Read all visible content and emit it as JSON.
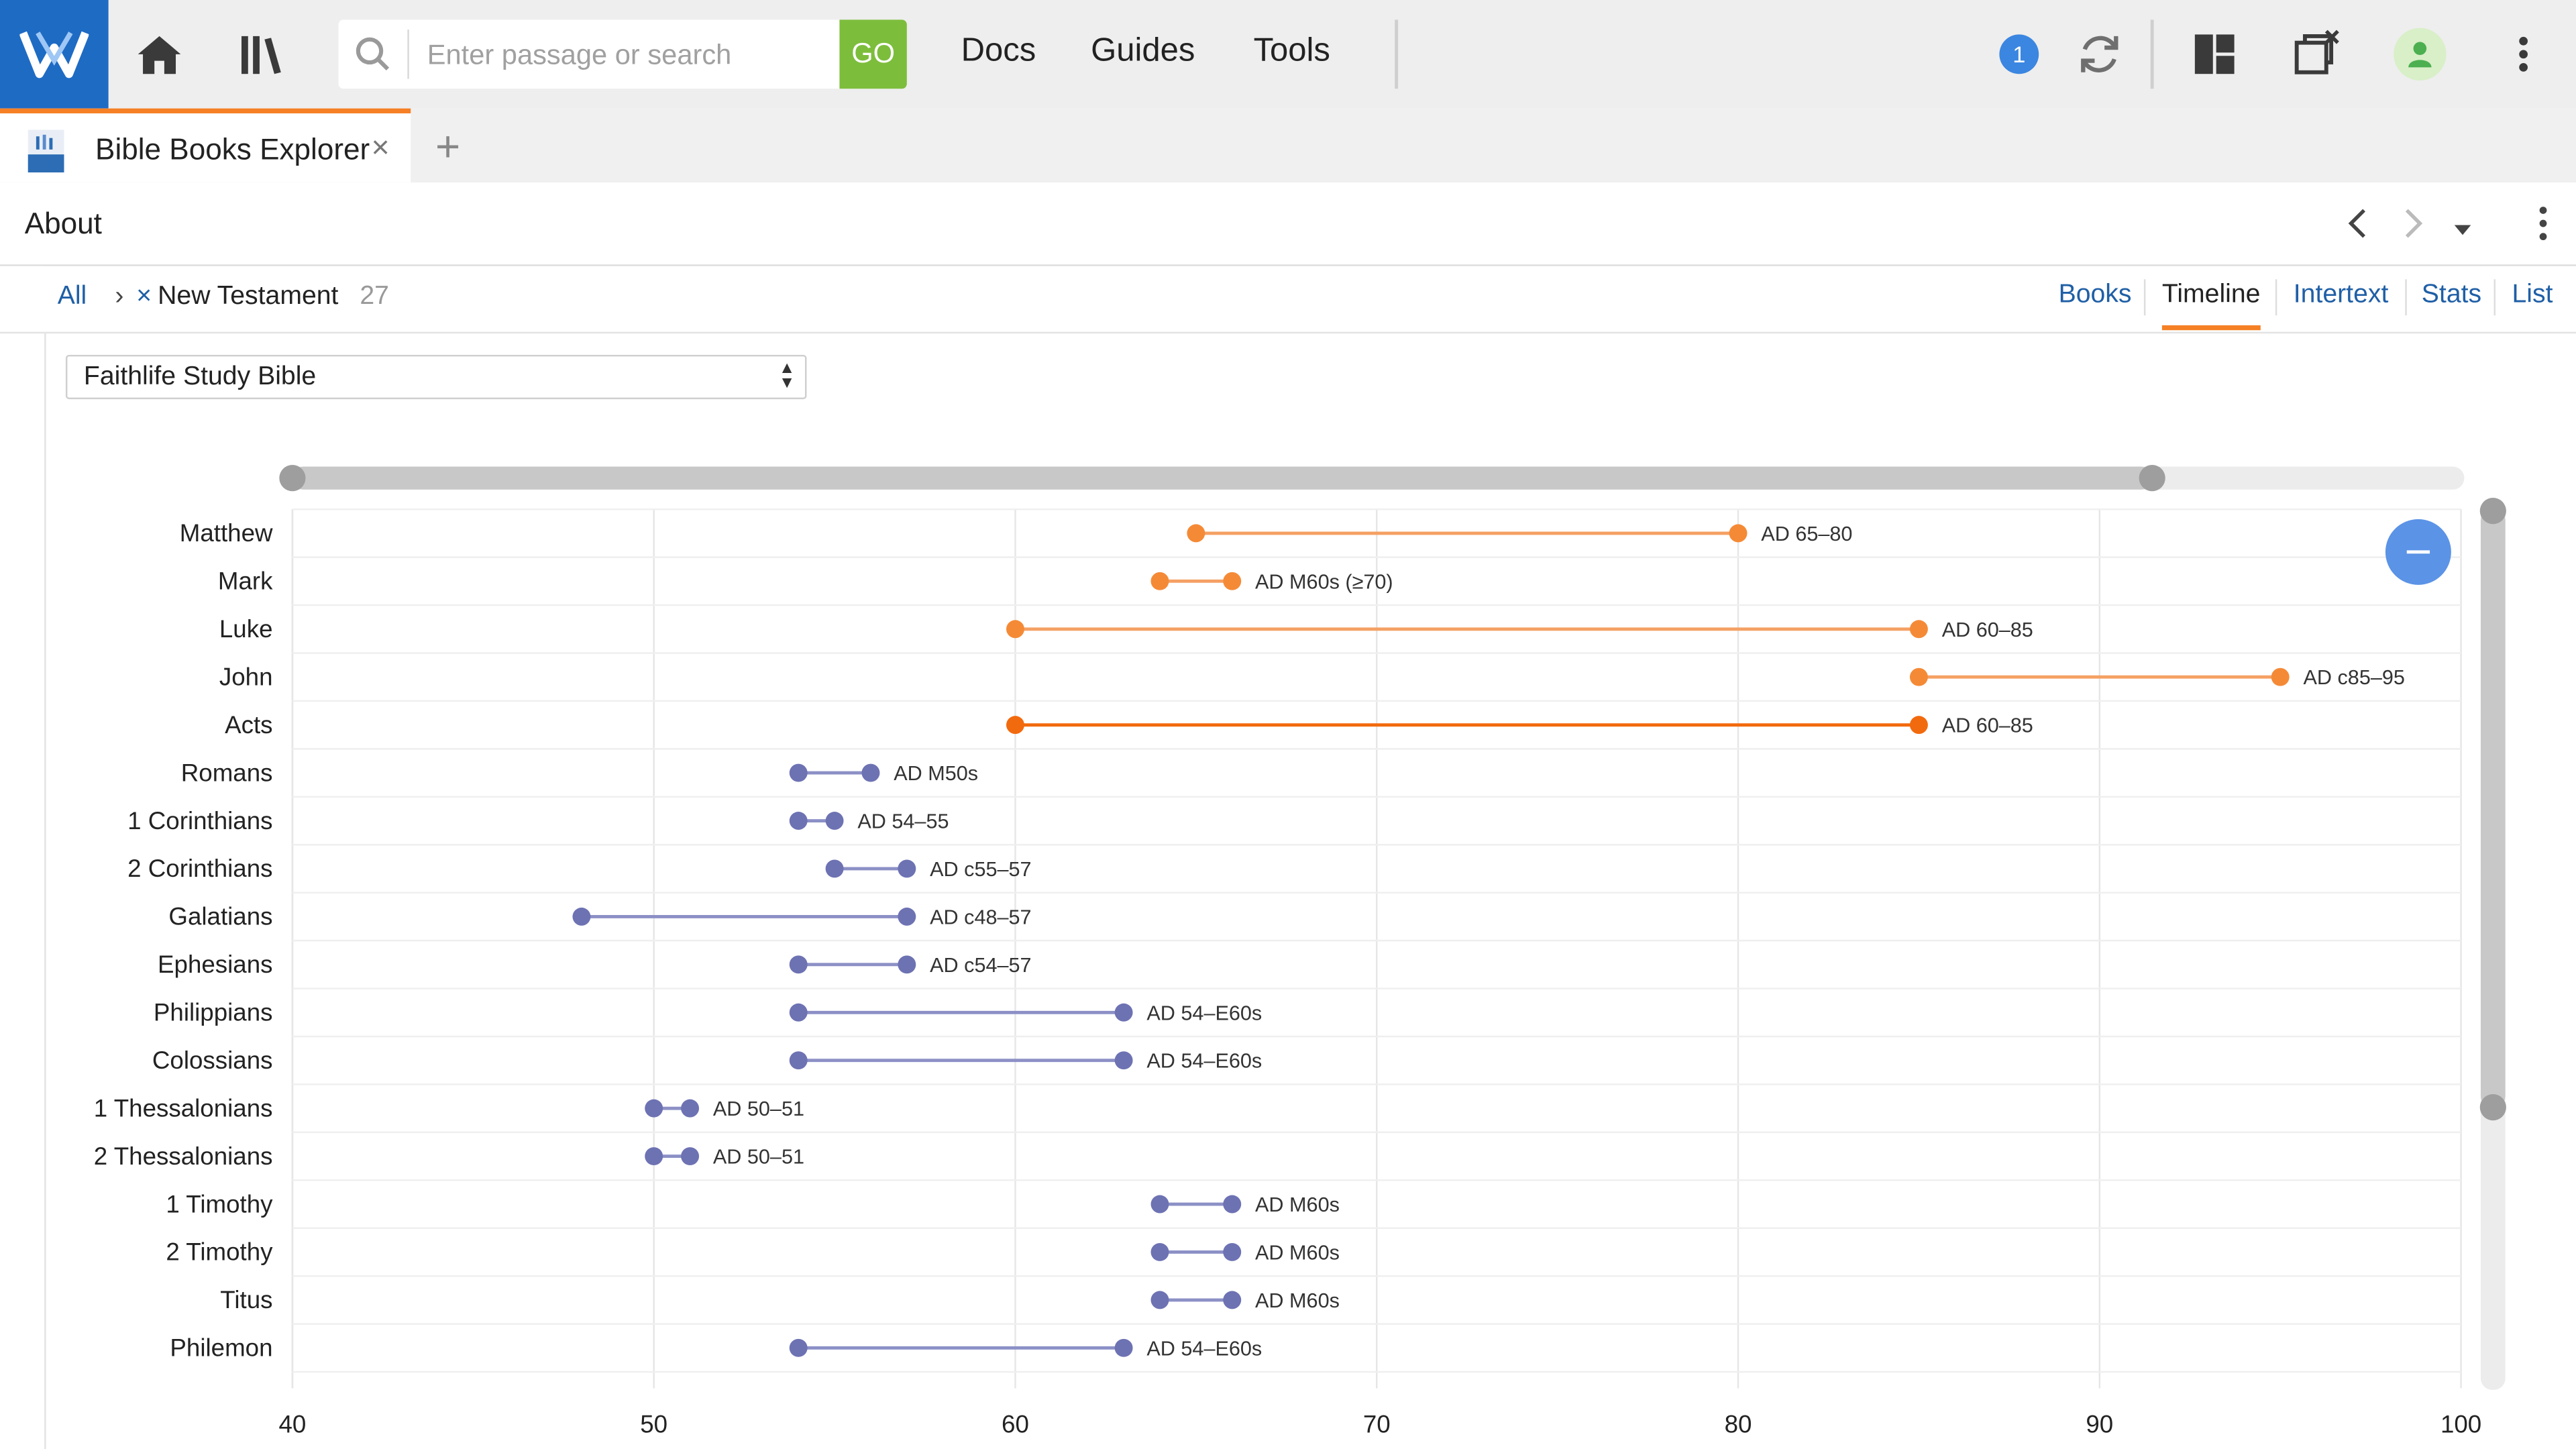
{
  "toolbar": {
    "search_placeholder": "Enter passage or search",
    "go_label": "GO",
    "menu": [
      "Docs",
      "Guides",
      "Tools"
    ],
    "notification_count": "1",
    "icons": [
      "logo-icon",
      "home-icon",
      "library-icon",
      "search-icon",
      "sync-icon",
      "layout-icon",
      "close-panels-icon",
      "user-icon",
      "more-vertical-icon"
    ]
  },
  "tab": {
    "title": "Bible Books Explorer",
    "close": "×",
    "add": "+"
  },
  "panel": {
    "title": "About",
    "icons": [
      "back-icon",
      "forward-icon",
      "dropdown-icon",
      "more-vertical-icon"
    ]
  },
  "filter": {
    "expand": "»",
    "all": "All",
    "separator": "›",
    "remove": "×",
    "selected": "New Testament",
    "count": "27"
  },
  "views": [
    "Books",
    "Timeline",
    "Intertext",
    "Stats",
    "List"
  ],
  "active_view": "Timeline",
  "source_select": {
    "value": "Faithlife Study Bible"
  },
  "colors": {
    "accent": "#f58025",
    "gospel": "#f58025",
    "epistle": "#6d72b3",
    "brand": "#1e6bc4",
    "link": "#1f5fa6"
  },
  "chart_data": {
    "type": "timeline",
    "xlim": [
      40,
      100
    ],
    "x_ticks": [
      40,
      50,
      60,
      70,
      80,
      90,
      100
    ],
    "grid": "vertical",
    "rows": [
      {
        "book": "Matthew",
        "start": 65,
        "end": 80,
        "label": "AD 65–80",
        "group": "gospel"
      },
      {
        "book": "Mark",
        "start": 64,
        "end": 66,
        "label": "AD M60s (≥70)",
        "group": "gospel"
      },
      {
        "book": "Luke",
        "start": 60,
        "end": 85,
        "label": "AD 60–85",
        "group": "gospel"
      },
      {
        "book": "John",
        "start": 85,
        "end": 95,
        "label": "AD c85–95",
        "group": "gospel"
      },
      {
        "book": "Acts",
        "start": 60,
        "end": 85,
        "label": "AD 60–85",
        "group": "acts"
      },
      {
        "book": "Romans",
        "start": 54,
        "end": 56,
        "label": "AD M50s",
        "group": "epistle"
      },
      {
        "book": "1 Corinthians",
        "start": 54,
        "end": 55,
        "label": "AD 54–55",
        "group": "epistle"
      },
      {
        "book": "2 Corinthians",
        "start": 55,
        "end": 57,
        "label": "AD c55–57",
        "group": "epistle"
      },
      {
        "book": "Galatians",
        "start": 48,
        "end": 57,
        "label": "AD c48–57",
        "group": "epistle"
      },
      {
        "book": "Ephesians",
        "start": 54,
        "end": 57,
        "label": "AD c54–57",
        "group": "epistle"
      },
      {
        "book": "Philippians",
        "start": 54,
        "end": 63,
        "label": "AD 54–E60s",
        "group": "epistle"
      },
      {
        "book": "Colossians",
        "start": 54,
        "end": 63,
        "label": "AD 54–E60s",
        "group": "epistle"
      },
      {
        "book": "1 Thessalonians",
        "start": 50,
        "end": 51,
        "label": "AD 50–51",
        "group": "epistle"
      },
      {
        "book": "2 Thessalonians",
        "start": 50,
        "end": 51,
        "label": "AD 50–51",
        "group": "epistle"
      },
      {
        "book": "1 Timothy",
        "start": 64,
        "end": 66,
        "label": "AD M60s",
        "group": "epistle"
      },
      {
        "book": "2 Timothy",
        "start": 64,
        "end": 66,
        "label": "AD M60s",
        "group": "epistle"
      },
      {
        "book": "Titus",
        "start": 64,
        "end": 66,
        "label": "AD M60s",
        "group": "epistle"
      },
      {
        "book": "Philemon",
        "start": 54,
        "end": 63,
        "label": "AD 54–E60s",
        "group": "epistle"
      }
    ]
  }
}
